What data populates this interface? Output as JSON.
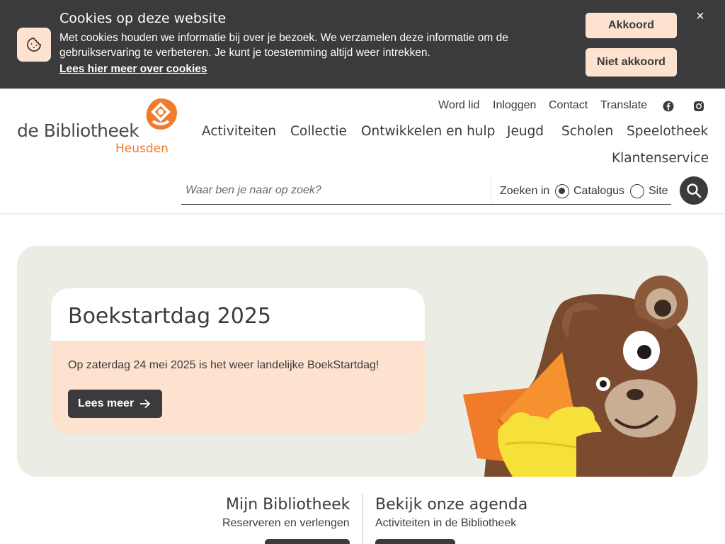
{
  "cookie": {
    "title": "Cookies op deze website",
    "text": "Met cookies houden we informatie bij over je bezoek. We verzamelen deze informatie om de gebruikservaring te verbeteren. Je kunt je toestemming altijd weer intrekken.",
    "link": "Lees hier meer over cookies",
    "accept_label": "Akkoord",
    "decline_label": "Niet akkoord",
    "close_label": "×",
    "icon": "cookie-icon"
  },
  "logo": {
    "line1": "de Bibliotheek",
    "line2": "Heusden"
  },
  "top_links": {
    "items": [
      "Word lid",
      "Inloggen",
      "Contact",
      "Translate"
    ],
    "social": [
      "facebook-icon",
      "instagram-icon"
    ]
  },
  "main_nav": {
    "items": [
      "Activiteiten",
      "Collectie",
      "Ontwikkelen en hulp",
      "Jeugd",
      "Scholen",
      "Speelotheek",
      "Klantenservice"
    ]
  },
  "search": {
    "placeholder": "Waar ben je naar op zoek?",
    "scope_label": "Zoeken in",
    "options": [
      "Catalogus",
      "Site"
    ],
    "selected": "Catalogus",
    "button_icon": "search-icon"
  },
  "hero": {
    "title": "Boekstartdag 2025",
    "text": "Op zaterdag 24 mei 2025 is het weer landelijke BoekStartdag!",
    "button_label": "Lees meer"
  },
  "columns": [
    {
      "title": "Mijn Bibliotheek",
      "subtitle": "Reserveren en verlengen"
    },
    {
      "title": "Bekijk onze agenda",
      "subtitle": "Activiteiten in de Bibliotheek"
    }
  ],
  "colors": {
    "dark": "#3b3a3c",
    "accent": "#f07b2a",
    "peach": "#fde3cf",
    "hero_bg": "#ebede5"
  }
}
